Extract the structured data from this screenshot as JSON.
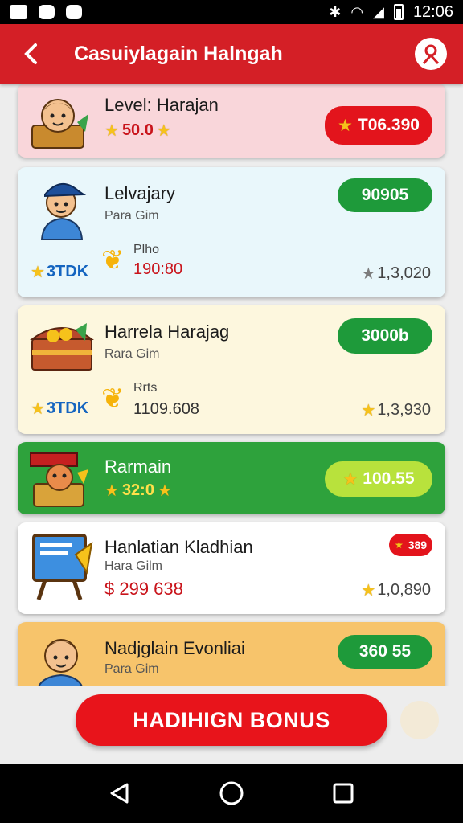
{
  "status_bar": {
    "time": "12:06"
  },
  "header": {
    "title": "Casuiylagain Halngah"
  },
  "cards": [
    {
      "title": "Level: Harajan",
      "score": "50.0",
      "badge": "T06.390",
      "bg": "#f9d6da",
      "badge_color": "#e3141c"
    },
    {
      "title": "Lelvajary",
      "subtitle": "Para Gim",
      "badge": "90905",
      "left_stat": "3TDK",
      "prize_label": "Plho",
      "prize_value": "190:80",
      "total": "1,3,020",
      "bg": "#e9f7fb",
      "badge_color": "#1e9a3a"
    },
    {
      "title": "Harrela Harajag",
      "subtitle": "Rara Gim",
      "badge": "3000b",
      "left_stat": "3TDK",
      "prize_label": "Rrts",
      "prize_value": "1109.608",
      "total": "1,3,930",
      "bg": "#fdf7de",
      "badge_color": "#1e9a3a"
    },
    {
      "title": "Rarmain",
      "score": "32:0",
      "badge": "100.55",
      "bg": "#2ea23c",
      "badge_color": "#b8e23c"
    },
    {
      "title": "Hanlatian Kladhian",
      "subtitle": "Hara Gilm",
      "price": "$ 299 638",
      "small_badge": "389",
      "total": "1,0,890",
      "bg": "#ffffff",
      "badge_color": "#e3141c"
    },
    {
      "title": "Nadjglain Evonliai",
      "subtitle": "Para Gim",
      "badge": "360 55",
      "bg": "#f7c46b",
      "badge_color": "#1e9a3a"
    }
  ],
  "bonus_button": {
    "label": "HADIHIGN BONUS"
  }
}
